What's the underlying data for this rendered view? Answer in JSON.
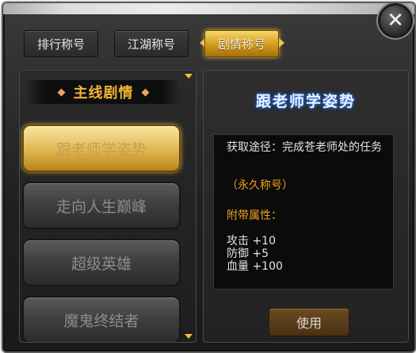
{
  "window": {
    "close_glyph": "✕"
  },
  "tabs": [
    {
      "label": "排行称号",
      "active": false
    },
    {
      "label": "江湖称号",
      "active": false
    },
    {
      "label": "剧情称号",
      "active": true
    }
  ],
  "left_panel": {
    "category": "主线剧情",
    "items": [
      {
        "label": "跟老师学姿势",
        "selected": true
      },
      {
        "label": "走向人生巅峰",
        "selected": false
      },
      {
        "label": "超级英雄",
        "selected": false
      },
      {
        "label": "魔鬼终结者",
        "selected": false
      }
    ]
  },
  "detail": {
    "title": "跟老师学姿势",
    "source": "获取途径：完成苍老师处的任务",
    "duration": "（永久称号）",
    "attr_header": "附带属性：",
    "attributes": [
      {
        "name": "攻击",
        "value": "+10"
      },
      {
        "name": "防御",
        "value": "+5"
      },
      {
        "name": "血量",
        "value": "+100"
      }
    ],
    "use_label": "使用"
  },
  "colors": {
    "accent_gold": "#f3b536",
    "attribute_orange": "#f0a020",
    "title_glow_blue": "#2c6fd6"
  }
}
